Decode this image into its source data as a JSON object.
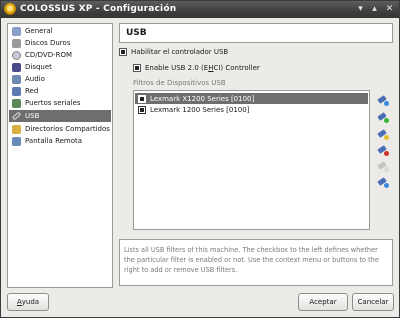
{
  "window": {
    "title": "COLOSSUS XP - Configuración"
  },
  "sidebar": {
    "items": [
      {
        "label": "General",
        "icon": "general-icon",
        "color": "#8aa0c8"
      },
      {
        "label": "Discos Duros",
        "icon": "hard-disk-icon",
        "color": "#9a9a9a"
      },
      {
        "label": "CD/DVD-ROM",
        "icon": "cd-dvd-icon",
        "color": "#c8c8d8"
      },
      {
        "label": "Disquet",
        "icon": "floppy-icon",
        "color": "#4a4a8a"
      },
      {
        "label": "Audio",
        "icon": "audio-icon",
        "color": "#6d8bb0"
      },
      {
        "label": "Red",
        "icon": "network-icon",
        "color": "#5a7ab0"
      },
      {
        "label": "Puertos seriales",
        "icon": "serial-port-icon",
        "color": "#5a8a5a"
      },
      {
        "label": "USB",
        "icon": "usb-icon",
        "color": "#e0e0e0",
        "selected": true
      },
      {
        "label": "Directorios Compartidos",
        "icon": "shared-folder-icon",
        "color": "#d8b040"
      },
      {
        "label": "Pantalla Remota",
        "icon": "remote-display-icon",
        "color": "#6a8ab8"
      }
    ]
  },
  "usb": {
    "title": "USB",
    "enable_controller": "Habilitar el controlador USB",
    "enable_ehci": {
      "prefix": "Enable USB 2.0 (E",
      "hotkey": "H",
      "suffix": "CI) Controller"
    },
    "filters_label": "Filtros de Dispositivos USB",
    "filters": [
      {
        "name": "Lexmark X1200 Series [0100]",
        "checked": true,
        "selected": true
      },
      {
        "name": "Lexmark 1200 Series [0100]",
        "checked": true,
        "selected": false
      }
    ],
    "tools": [
      {
        "name": "new-filter-icon",
        "mark": "#3a86e0",
        "enabled": true
      },
      {
        "name": "add-from-device-icon",
        "mark": "#3cb43c",
        "enabled": true
      },
      {
        "name": "edit-filter-icon",
        "mark": "#e0c030",
        "enabled": true
      },
      {
        "name": "remove-filter-icon",
        "mark": "#d03030",
        "enabled": true
      },
      {
        "name": "move-up-icon",
        "mark": "#cccccc",
        "enabled": false
      },
      {
        "name": "move-down-icon",
        "mark": "#3a86e0",
        "enabled": true
      }
    ],
    "description": "Lists all USB filters of this machine. The checkbox to the left defines whether the particular filter is enabled or not. Use the context menu or buttons to the right to add or remove USB filters."
  },
  "buttons": {
    "help": {
      "hotkey": "A",
      "rest": "yuda"
    },
    "ok": "Aceptar",
    "cancel": "Cancelar"
  }
}
